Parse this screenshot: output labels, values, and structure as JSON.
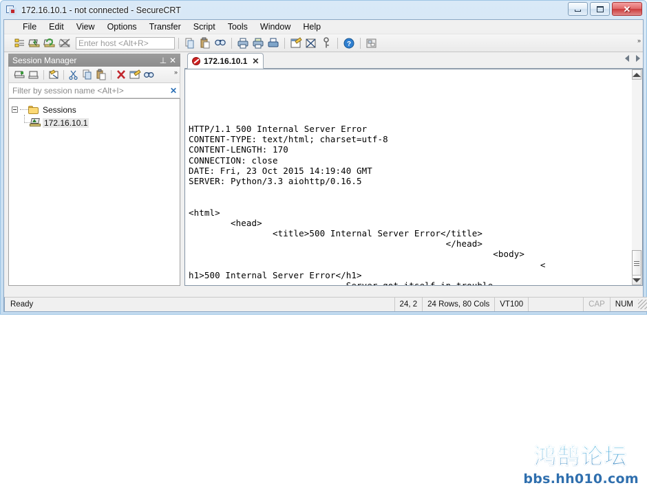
{
  "window": {
    "title": "172.16.10.1 - not connected - SecureCRT",
    "icon": "securecrt-app-icon",
    "minimize_label": "",
    "maximize_label": "",
    "close_label": "✕"
  },
  "menubar": {
    "items": [
      {
        "label": "File"
      },
      {
        "label": "Edit"
      },
      {
        "label": "View"
      },
      {
        "label": "Options"
      },
      {
        "label": "Transfer"
      },
      {
        "label": "Script"
      },
      {
        "label": "Tools"
      },
      {
        "label": "Window"
      },
      {
        "label": "Help"
      }
    ]
  },
  "toolbar": {
    "host_placeholder": "Enter host <Alt+R>",
    "host_value": "",
    "overflow_label": "»",
    "icons": [
      {
        "name": "session-manager-icon"
      },
      {
        "name": "connect-icon"
      },
      {
        "name": "reconnect-icon"
      },
      {
        "name": "disconnect-icon"
      },
      {
        "name": "copy-icon"
      },
      {
        "name": "paste-icon"
      },
      {
        "name": "find-icon"
      },
      {
        "name": "print-icon"
      },
      {
        "name": "log-session-icon"
      },
      {
        "name": "print-screen-icon"
      },
      {
        "name": "session-options-icon"
      },
      {
        "name": "global-options-icon"
      },
      {
        "name": "key-icon"
      },
      {
        "name": "help-icon"
      },
      {
        "name": "tile-windows-icon"
      }
    ]
  },
  "session_manager": {
    "title": "Session Manager",
    "pin_label": "⊥",
    "close_label": "✕",
    "overflow_label": "»",
    "toolbar_icons": [
      {
        "name": "new-session-icon"
      },
      {
        "name": "new-folder-icon"
      },
      {
        "name": "connect-in-tab-icon"
      },
      {
        "name": "cut-icon"
      },
      {
        "name": "copy-icon"
      },
      {
        "name": "paste-icon"
      },
      {
        "name": "delete-icon"
      },
      {
        "name": "properties-icon"
      },
      {
        "name": "find-icon"
      }
    ],
    "filter_placeholder": "Filter by session name <Alt+I>",
    "filter_value": "",
    "filter_clear_label": "✕",
    "tree": {
      "root_label": "Sessions",
      "sessions": [
        {
          "label": "172.16.10.1",
          "selected": true
        }
      ]
    }
  },
  "terminal": {
    "tab": {
      "label": "172.16.10.1",
      "status_icon": "disconnected-icon",
      "close_label": "✕"
    },
    "nav_prev": "◁",
    "nav_next": "▷",
    "content": "\n\n\n\n\nHTTP/1.1 500 Internal Server Error\nCONTENT-TYPE: text/html; charset=utf-8\nCONTENT-LENGTH: 170\nCONNECTION: close\nDATE: Fri, 23 Oct 2015 14:19:40 GMT\nSERVER: Python/3.3 aiohttp/0.16.5\n\n\n<html>\n        <head>\n                <title>500 Internal Server Error</title>\n                                                 </head>\n                                                          <body>\n                                                                   <\nh1>500 Internal Server Error</h1>\n                              Server got itself in trouble\n                                                            </body>\n                                                                    </html\n>"
  },
  "statusbar": {
    "ready": "Ready",
    "cursor": "24,  2",
    "dimensions": "24 Rows, 80 Cols",
    "emulation": "VT100",
    "spacer": "",
    "caps": "CAP",
    "num": "NUM"
  },
  "watermark": {
    "cn": "鸿鹄论坛",
    "url": "bbs.hh010.com"
  }
}
